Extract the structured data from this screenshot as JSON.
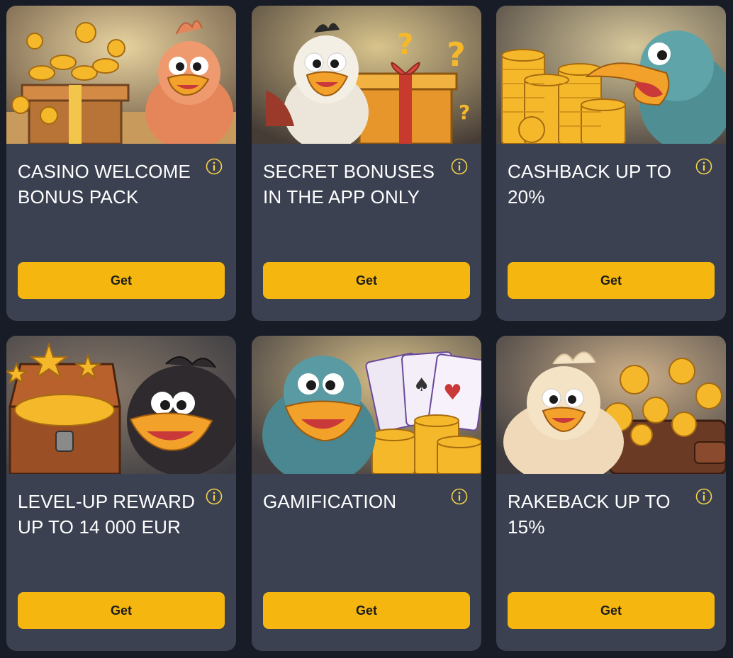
{
  "colors": {
    "page_background": "#171c27",
    "card_background": "#3b4151",
    "accent": "#f5b70f",
    "title_text": "#ffffff",
    "button_text": "#1a1a1a"
  },
  "cards": [
    {
      "title": "CASINO WELCOME BONUS PACK",
      "button_label": "Get",
      "info_icon": "info-circle-icon",
      "image": "chicken-with-gift-box-and-coins"
    },
    {
      "title": "SECRET BONUSES IN THE APP ONLY",
      "button_label": "Get",
      "info_icon": "info-circle-icon",
      "image": "white-bird-with-gift-and-question-marks"
    },
    {
      "title": "CASHBACK UP TO 20%",
      "button_label": "Get",
      "info_icon": "info-circle-icon",
      "image": "teal-bird-with-coin-stacks"
    },
    {
      "title": "LEVEL-UP REWARD UP TO 14 000 EUR",
      "button_label": "Get",
      "info_icon": "info-circle-icon",
      "image": "black-bird-with-treasure-chest-and-stars"
    },
    {
      "title": "GAMIFICATION",
      "button_label": "Get",
      "info_icon": "info-circle-icon",
      "image": "teal-bird-with-playing-cards-and-chips"
    },
    {
      "title": "RAKEBACK UP TO 15%",
      "button_label": "Get",
      "info_icon": "info-circle-icon",
      "image": "cream-chicken-with-wallet-and-coins"
    }
  ]
}
